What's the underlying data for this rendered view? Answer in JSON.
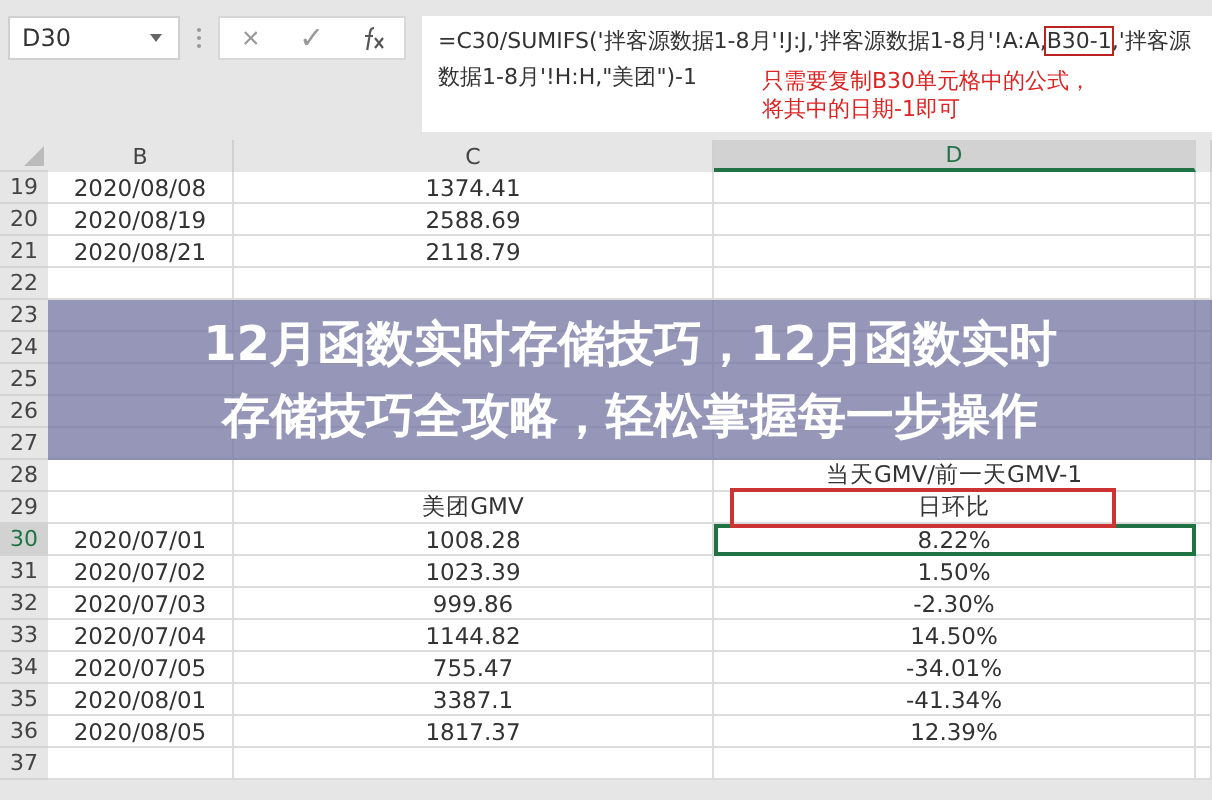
{
  "formula_bar": {
    "name_box": "D30",
    "cancel": "×",
    "enter": "✓",
    "formula_before": "=C30/SUMIFS('拌客源数据1-8月'!J:J,'拌客源数据1-8月'!A:A,",
    "formula_highlight": "B30-1",
    "formula_after": ",'拌客源数据1-8月'!H:H,\"美团\")-1",
    "note": "只需要复制B30单元格中的公式，将其中的日期-1即可"
  },
  "columns": [
    {
      "label": "B",
      "selected": false
    },
    {
      "label": "C",
      "selected": false
    },
    {
      "label": "D",
      "selected": true
    }
  ],
  "rows": [
    {
      "num": "19",
      "selected": false,
      "b": "2020/08/08",
      "c": "1374.41"
    },
    {
      "num": "20",
      "selected": false,
      "b": "2020/08/19",
      "c": "2588.69"
    },
    {
      "num": "21",
      "selected": false,
      "b": "2020/08/21",
      "c": "2118.79"
    },
    {
      "num": "22",
      "selected": false
    },
    {
      "num": "23",
      "selected": false
    },
    {
      "num": "24",
      "selected": false
    },
    {
      "num": "25",
      "selected": false
    },
    {
      "num": "26",
      "selected": false
    },
    {
      "num": "27",
      "selected": false
    },
    {
      "num": "28",
      "selected": false,
      "d": "当天GMV/前一天GMV-1"
    },
    {
      "num": "29",
      "selected": false,
      "c": "美团GMV",
      "d": "日环比"
    },
    {
      "num": "30",
      "selected": true,
      "b": "2020/07/01",
      "c": "1008.28",
      "d": "8.22%"
    },
    {
      "num": "31",
      "selected": false,
      "b": "2020/07/02",
      "c": "1023.39",
      "d": "1.50%"
    },
    {
      "num": "32",
      "selected": false,
      "b": "2020/07/03",
      "c": "999.86",
      "d": "-2.30%"
    },
    {
      "num": "33",
      "selected": false,
      "b": "2020/07/04",
      "c": "1144.82",
      "d": "14.50%"
    },
    {
      "num": "34",
      "selected": false,
      "b": "2020/07/05",
      "c": "755.47",
      "d": "-34.01%"
    },
    {
      "num": "35",
      "selected": false,
      "b": "2020/08/01",
      "c": "3387.1",
      "d": "-41.34%"
    },
    {
      "num": "36",
      "selected": false,
      "b": "2020/08/05",
      "c": "1817.37",
      "d": "12.39%"
    },
    {
      "num": "37",
      "selected": false
    }
  ],
  "banner": {
    "lines": [
      "12月函数实时存储技巧，12月函数实时",
      "存储技巧全攻略，轻松掌握每一步操作"
    ]
  }
}
